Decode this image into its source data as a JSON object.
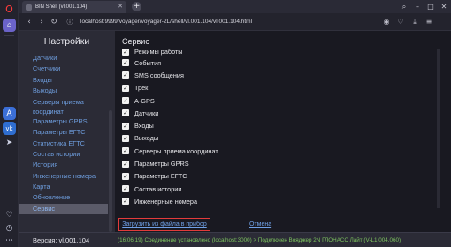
{
  "browser": {
    "tab_title": "BIN Shell (vl.001.104)",
    "url": "localhost:9999/voyager/voyager-2L/shell/vl.001.104/vl.001.104.html"
  },
  "sidebar": {
    "title": "Настройки",
    "items": [
      {
        "label": "Датчики"
      },
      {
        "label": "Счетчики"
      },
      {
        "label": "Входы"
      },
      {
        "label": "Выходы"
      },
      {
        "label": "Серверы приема координат"
      },
      {
        "label": "Параметры GPRS"
      },
      {
        "label": "Параметры ЕГТС"
      },
      {
        "label": "Статистика ЕГТС"
      },
      {
        "label": "Состав истории"
      },
      {
        "label": "История"
      },
      {
        "label": "Инженерные номера"
      },
      {
        "label": "Карта"
      },
      {
        "label": "Обновление"
      },
      {
        "label": "Сервис"
      }
    ]
  },
  "content": {
    "title": "Сервис",
    "checkboxes": [
      {
        "label": "Режимы работы",
        "checked": true
      },
      {
        "label": "События",
        "checked": true
      },
      {
        "label": "SMS сообщения",
        "checked": true
      },
      {
        "label": "Трек",
        "checked": true
      },
      {
        "label": "A-GPS",
        "checked": true
      },
      {
        "label": "Датчики",
        "checked": true
      },
      {
        "label": "Входы",
        "checked": true
      },
      {
        "label": "Выходы",
        "checked": true
      },
      {
        "label": "Серверы приема координат",
        "checked": true
      },
      {
        "label": "Параметры GPRS",
        "checked": true
      },
      {
        "label": "Параметры ЕГТС",
        "checked": true
      },
      {
        "label": "Состав истории",
        "checked": true
      },
      {
        "label": "Инженерные номера",
        "checked": true
      }
    ],
    "upload_button": "Загрузить из файла в прибор",
    "cancel_link": "Отмена",
    "check_mark": "✓"
  },
  "status": {
    "version": "Версия: vl.001.104",
    "message": "(16:06:19) Соединение установлено (localhost:3000) > Подключен Вояджер 2N ГЛОНАСС Лайт (V-L1.004.060)"
  },
  "colors": {
    "accent_link": "#6fa0e6",
    "status_green": "#7ec460",
    "highlight_border": "#e23b3b"
  }
}
